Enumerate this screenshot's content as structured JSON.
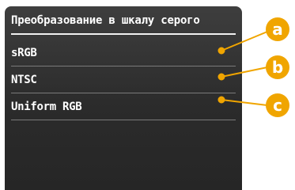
{
  "screen": {
    "title": "Преобразование в шкалу серого",
    "items": [
      {
        "label": "sRGB"
      },
      {
        "label": "NTSC"
      },
      {
        "label": "Uniform RGB"
      }
    ]
  },
  "callouts": [
    "a",
    "b",
    "c"
  ],
  "colors": {
    "panel_background": "#2b2b2b",
    "text": "#ffffff",
    "callout_accent": "#f0a500"
  }
}
